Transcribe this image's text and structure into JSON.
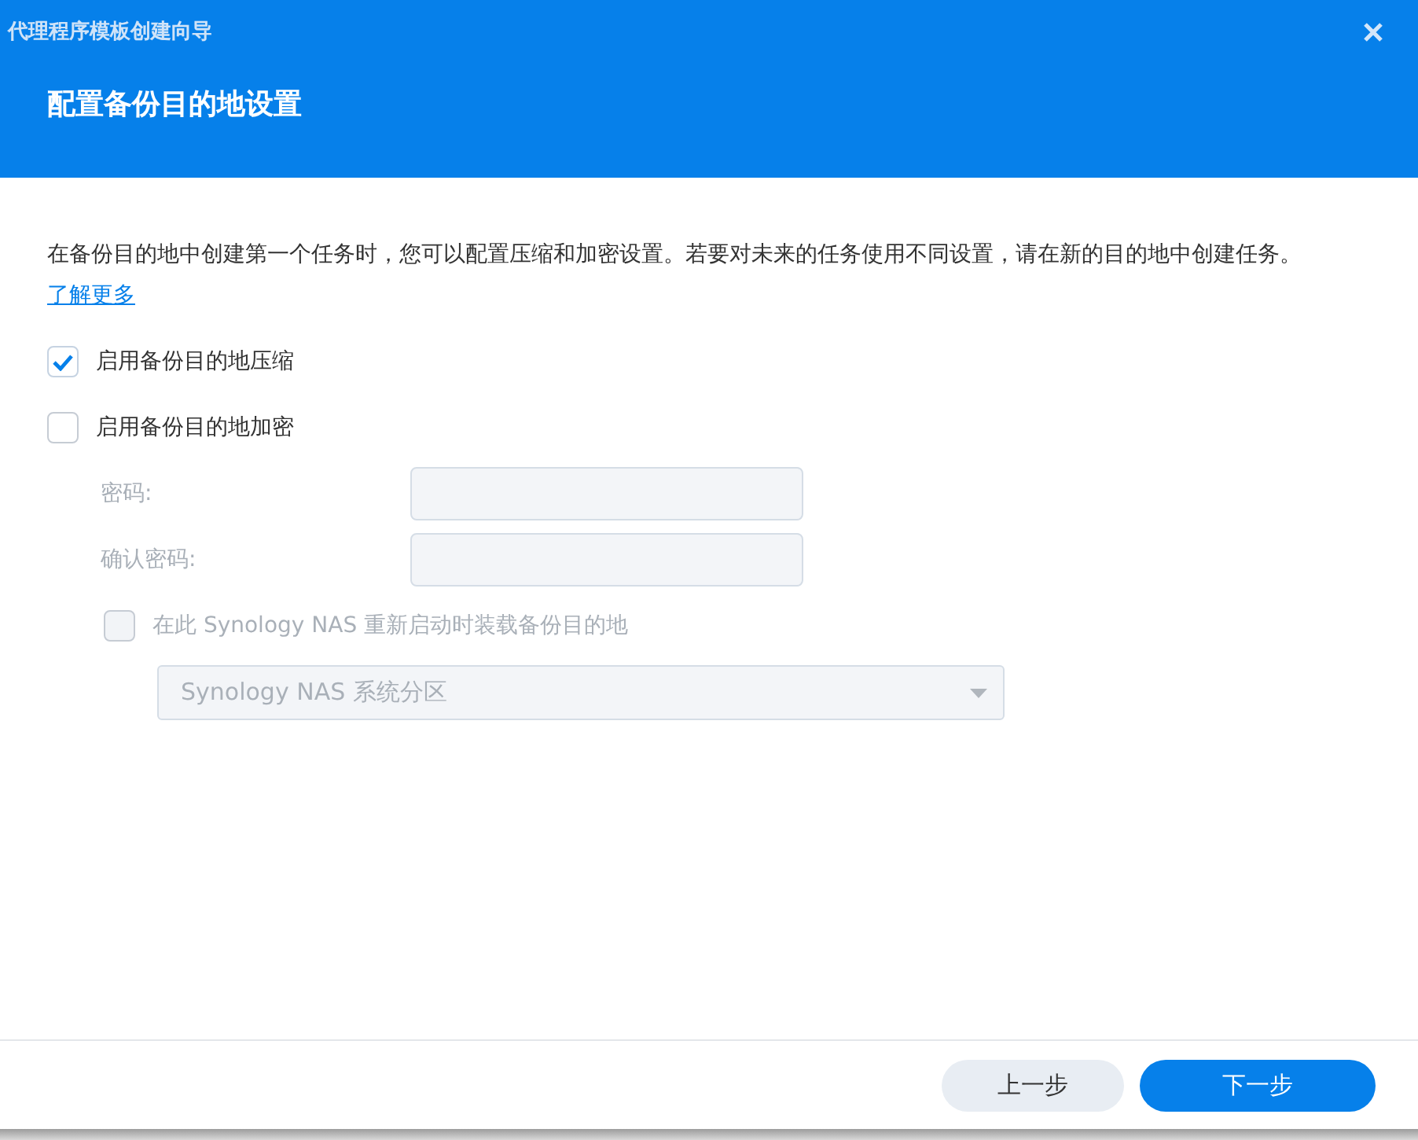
{
  "window": {
    "title": "代理程序模板创建向导"
  },
  "header": {
    "heading": "配置备份目的地设置"
  },
  "description": {
    "text": "在备份目的地中创建第一个任务时，您可以配置压缩和加密设置。若要对未来的任务使用不同设置，请在新的目的地中创建任务。",
    "link": "了解更多"
  },
  "options": [
    {
      "label": "启用备份目的地压缩",
      "checked": true,
      "disabled": false
    },
    {
      "label": "启用备份目的地加密",
      "checked": false,
      "disabled": false
    }
  ],
  "fields": [
    {
      "label": "密码:",
      "disabled": true
    },
    {
      "label": "确认密码:",
      "disabled": true
    }
  ],
  "mount_option": {
    "label": "在此 Synology NAS 重新启动时装载备份目的地",
    "checked": false,
    "disabled": true
  },
  "volume_select": {
    "value": "Synology NAS 系统分区",
    "disabled": true
  },
  "buttons": [
    {
      "label": "上一步",
      "kind": "secondary"
    },
    {
      "label": "下一步",
      "kind": "primary"
    }
  ]
}
